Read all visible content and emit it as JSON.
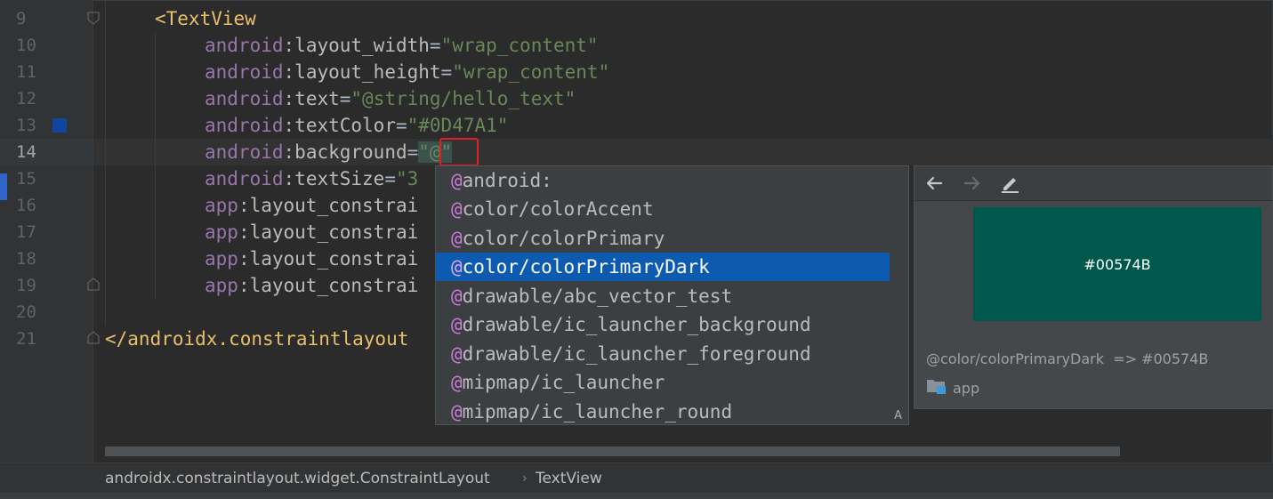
{
  "editor": {
    "line_numbers": [
      "9",
      "10",
      "11",
      "12",
      "13",
      "14",
      "15",
      "16",
      "17",
      "18",
      "19",
      "20",
      "21"
    ],
    "lines": {
      "l9_tag": "<TextView",
      "ns_android": "android",
      "ns_app": "app",
      "colon": ":",
      "eq": "=",
      "l10_attr": "layout_width",
      "l10_val": "\"wrap_content\"",
      "l11_attr": "layout_height",
      "l11_val": "\"wrap_content\"",
      "l12_attr": "text",
      "l12_val": "\"@string/hello_text\"",
      "l13_attr": "textColor",
      "l13_val": "\"#0D47A1\"",
      "l14_attr": "background",
      "l14_val": "\"@\"",
      "l15_attr": "textSize",
      "l15_val": "\"3",
      "l16_attr": "layout_constrai",
      "l17_attr": "layout_constrai",
      "l18_attr": "layout_constrai",
      "l19_attr": "layout_constrai",
      "l21_tag": "</androidx.constraintlayout"
    },
    "text_color_swatch": "#0D47A1"
  },
  "completion": {
    "items": [
      {
        "at": "@",
        "rest": "android:"
      },
      {
        "at": "@",
        "rest": "color/colorAccent"
      },
      {
        "at": "@",
        "rest": "color/colorPrimary"
      },
      {
        "at": "@",
        "rest": "color/colorPrimaryDark"
      },
      {
        "at": "@",
        "rest": "drawable/abc_vector_test"
      },
      {
        "at": "@",
        "rest": "drawable/ic_launcher_background"
      },
      {
        "at": "@",
        "rest": "drawable/ic_launcher_foreground"
      },
      {
        "at": "@",
        "rest": "mipmap/ic_launcher"
      },
      {
        "at": "@",
        "rest": "mipmap/ic_launcher_round"
      }
    ],
    "selected_index": 3,
    "hint": "A"
  },
  "doc_panel": {
    "back_icon": "arrow-left-icon",
    "forward_icon": "arrow-right-icon",
    "edit_icon": "pencil-icon",
    "preview_color": "#00574B",
    "preview_label": "#00574B",
    "resolution": "@color/colorPrimaryDark  => #00574B",
    "module": "app"
  },
  "breadcrumb": {
    "items": [
      "androidx.constraintlayout.widget.ConstraintLayout",
      "TextView"
    ]
  }
}
